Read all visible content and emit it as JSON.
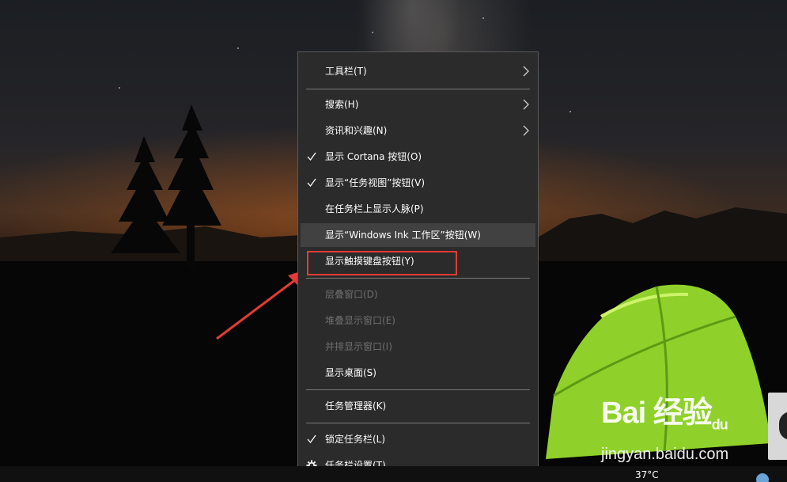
{
  "menu": {
    "items": [
      {
        "label": "工具栏(T)",
        "submenu": true
      },
      {
        "label": "搜索(H)",
        "submenu": true
      },
      {
        "label": "资讯和兴趣(N)",
        "submenu": true
      },
      {
        "label": "显示 Cortana 按钮(O)",
        "checked": true
      },
      {
        "label": "显示“任务视图”按钮(V)",
        "checked": true
      },
      {
        "label": "在任务栏上显示人脉(P)"
      },
      {
        "label": "显示“Windows Ink 工作区”按钮(W)",
        "hovered": true
      },
      {
        "label": "显示触摸键盘按钮(Y)",
        "highlighted": true
      },
      {
        "label": "层叠窗口(D)",
        "disabled": true
      },
      {
        "label": "堆叠显示窗口(E)",
        "disabled": true
      },
      {
        "label": "并排显示窗口(I)",
        "disabled": true
      },
      {
        "label": "显示桌面(S)"
      },
      {
        "label": "任务管理器(K)"
      },
      {
        "label": "锁定任务栏(L)",
        "checked": true
      },
      {
        "label": "任务栏设置(T)",
        "icon": "gear-icon"
      }
    ]
  },
  "taskbar": {
    "temperature": "37°C"
  },
  "watermark": {
    "brand": "Bai 经验",
    "brand_paw": "du",
    "url": "jingyan.baidu.com"
  },
  "colors": {
    "menu_bg": "#2b2b2b",
    "menu_hover": "#414141",
    "highlight_box": "#e53a35",
    "arrow": "#e53a35",
    "tent": "#9ad62a"
  }
}
